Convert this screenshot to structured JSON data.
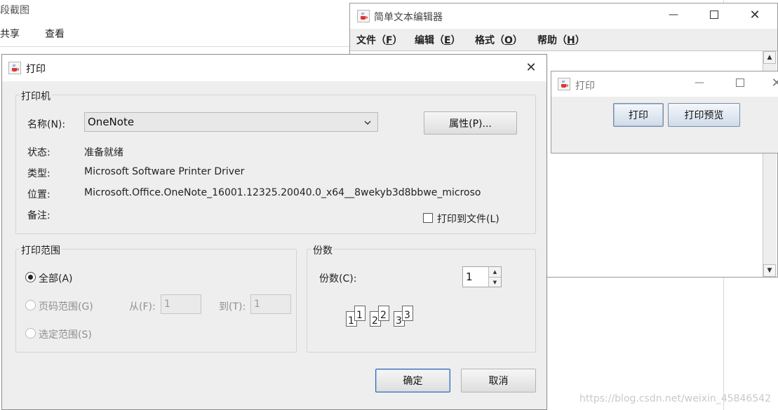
{
  "explorer": {
    "title_fragment": "段截图",
    "menu": [
      "共享",
      "查看"
    ]
  },
  "editor": {
    "title": "简单文本编辑器",
    "menu": [
      {
        "text": "文件（",
        "key": "F",
        "end": "）"
      },
      {
        "text": "编辑（",
        "key": "E",
        "end": "）"
      },
      {
        "text": "格式（",
        "key": "O",
        "end": "）"
      },
      {
        "text": "帮助（",
        "key": "H",
        "end": "）"
      }
    ]
  },
  "small_print": {
    "title": "打印",
    "print_button": "打印",
    "preview_button": "打印预览"
  },
  "dialog": {
    "title": "打印",
    "printer_group": "打印机",
    "name_label": "名称(N):",
    "printer_name": "OneNote",
    "properties_button": "属性(P)...",
    "status_label": "状态:",
    "status_value": "准备就绪",
    "type_label": "类型:",
    "type_value": "Microsoft Software Printer Driver",
    "location_label": "位置:",
    "location_value": "Microsoft.Office.OneNote_16001.12325.20040.0_x64__8wekyb3d8bbwe_microso",
    "comment_label": "备注:",
    "print_to_file": "打印到文件(L)",
    "print_to_file_checked": false,
    "range_group": "打印范围",
    "range_all": "全部(A)",
    "range_pages": "页码范围(G)",
    "range_from_label": "从(F):",
    "range_from_value": "1",
    "range_to_label": "到(T):",
    "range_to_value": "1",
    "range_selection": "选定范围(S)",
    "range_selected": "all",
    "copies_group": "份数",
    "copies_label": "份数(C):",
    "copies_value": "1",
    "collate_pages": [
      "1",
      "1",
      "2",
      "2",
      "3",
      "3"
    ],
    "ok_button": "确定",
    "cancel_button": "取消"
  },
  "watermark": "https://blog.csdn.net/weixin_45846542"
}
